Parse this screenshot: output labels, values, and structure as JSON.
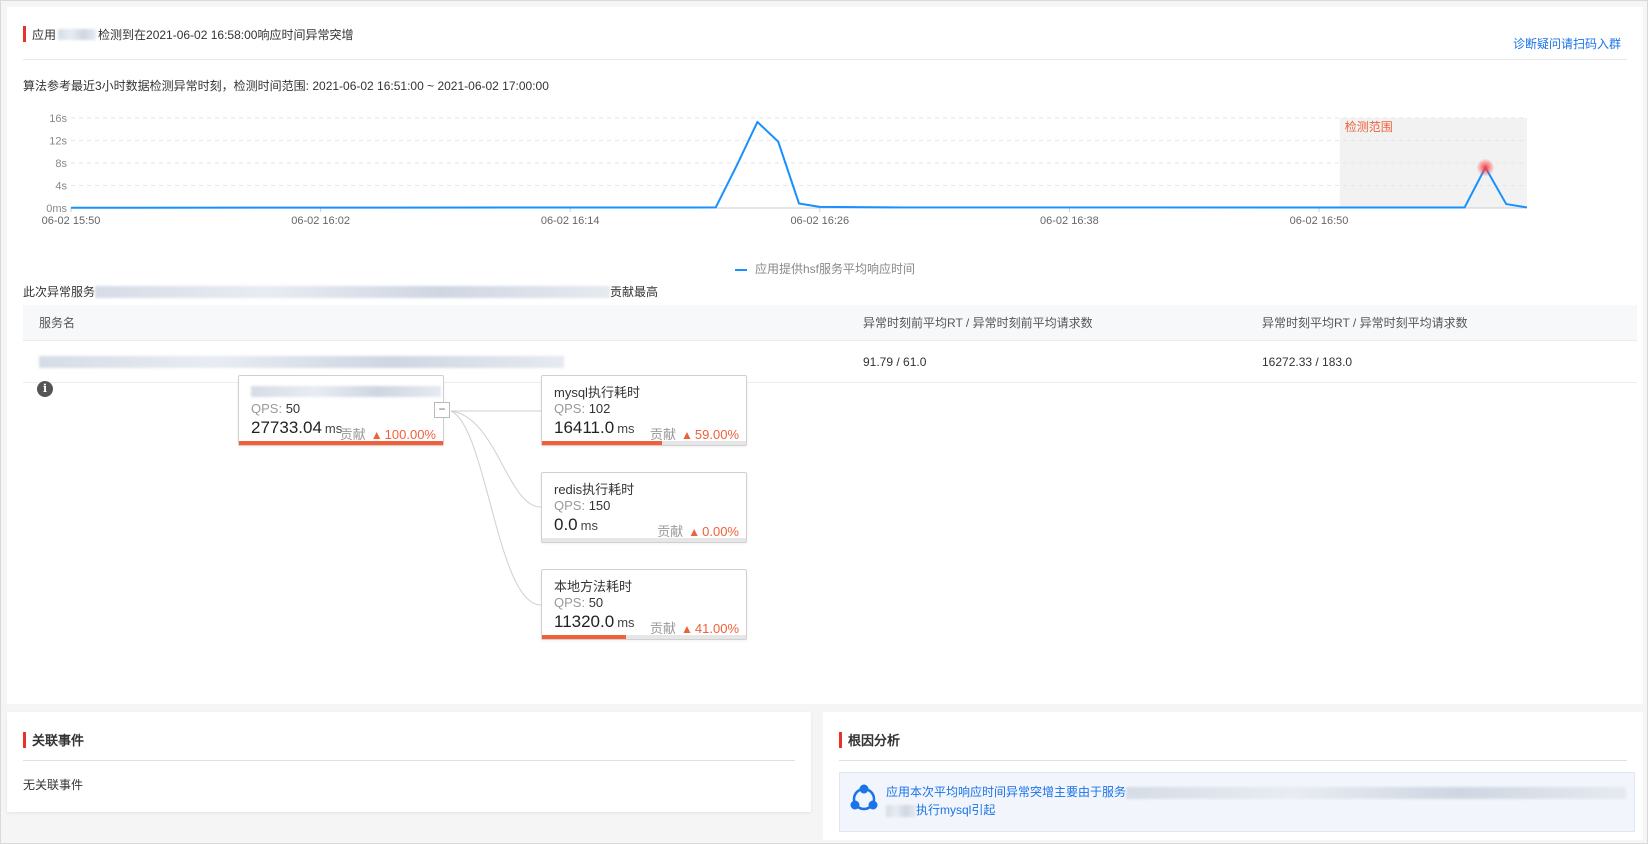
{
  "header": {
    "title_prefix": "应用",
    "title_suffix": "检测到在2021-06-02 16:58:00响应时间异常突增",
    "join_group_link": "诊断疑问请扫码入群",
    "algorithm_note": "算法参考最近3小时数据检测异常时刻，检测时间范围: 2021-06-02 16:51:00 ~ 2021-06-02 17:00:00"
  },
  "chart_data": {
    "type": "line",
    "x_ticks": [
      "06-02 15:50",
      "06-02 16:02",
      "06-02 16:14",
      "06-02 16:26",
      "06-02 16:38",
      "06-02 16:50"
    ],
    "y_ticks": [
      "0ms",
      "4s",
      "8s",
      "12s",
      "16s"
    ],
    "ylim": [
      0,
      16
    ],
    "y_unit": "s",
    "detect_range_label": "检测范围",
    "detect_range": [
      "16:51",
      "17:00"
    ],
    "grid": true,
    "legend_position": "bottom",
    "series": [
      {
        "name": "应用提供hsf服务平均响应时间",
        "color": "#1890ff",
        "points": [
          [
            "15:50",
            0.05
          ],
          [
            "16:00",
            0.06
          ],
          [
            "16:20",
            0.1
          ],
          [
            "16:21",
            0.12
          ],
          [
            "16:22",
            7.5
          ],
          [
            "16:23",
            15.3
          ],
          [
            "16:24",
            11.8
          ],
          [
            "16:25",
            0.8
          ],
          [
            "16:26",
            0.2
          ],
          [
            "16:30",
            0.1
          ],
          [
            "16:50",
            0.1
          ],
          [
            "16:57",
            0.1
          ],
          [
            "16:58",
            7.2
          ],
          [
            "16:59",
            0.7
          ],
          [
            "17:00",
            0.1
          ]
        ],
        "anomaly_point": [
          "16:58",
          7.2
        ]
      }
    ]
  },
  "contrib": {
    "prefix": "此次异常服务",
    "suffix": "贡献最高"
  },
  "table": {
    "headers": [
      "服务名",
      "异常时刻前平均RT / 异常时刻前平均请求数",
      "异常时刻平均RT / 异常时刻平均请求数"
    ],
    "rows": [
      {
        "before": "91.79 / 61.0",
        "during": "16272.33 / 183.0"
      }
    ]
  },
  "topology": {
    "root": {
      "qps_label": "QPS:",
      "qps": "50",
      "value": "27733.04",
      "unit": "ms",
      "contrib_label": "贡献",
      "pct": "100.00%",
      "ratio": 1.0
    },
    "collapse_symbol": "−",
    "children": [
      {
        "name": "mysql执行耗时",
        "qps_label": "QPS:",
        "qps": "102",
        "value": "16411.0",
        "unit": "ms",
        "contrib_label": "贡献",
        "pct": "59.00%",
        "ratio": 0.59
      },
      {
        "name": "redis执行耗时",
        "qps_label": "QPS:",
        "qps": "150",
        "value": "0.0",
        "unit": "ms",
        "contrib_label": "贡献",
        "pct": "0.00%",
        "ratio": 0.0
      },
      {
        "name": "本地方法耗时",
        "qps_label": "QPS:",
        "qps": "50",
        "value": "11320.0",
        "unit": "ms",
        "contrib_label": "贡献",
        "pct": "41.00%",
        "ratio": 0.41
      }
    ]
  },
  "events": {
    "title": "关联事件",
    "empty_text": "无关联事件"
  },
  "rca": {
    "title": "根因分析",
    "line1_prefix": "应用本次平均响应时间异常突增主要由于服务",
    "line2_suffix": "执行mysql引起"
  },
  "colors": {
    "accent_red": "#e5332a",
    "link_blue": "#1a73e8",
    "series_blue": "#1890ff",
    "contrib_orange": "#f0603c",
    "detect_label": "#f0603c"
  }
}
